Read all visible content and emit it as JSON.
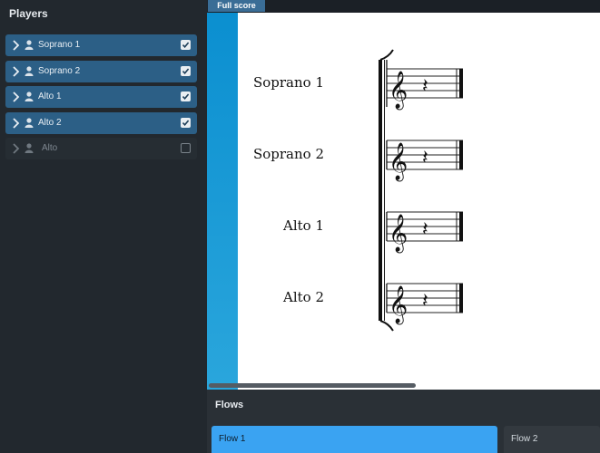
{
  "players_panel": {
    "title": "Players",
    "players": [
      {
        "name": "Soprano 1",
        "selected": true,
        "checked": true
      },
      {
        "name": "Soprano 2",
        "selected": true,
        "checked": true
      },
      {
        "name": "Alto 1",
        "selected": true,
        "checked": true
      },
      {
        "name": "Alto 2",
        "selected": true,
        "checked": true
      },
      {
        "name": "Alto",
        "selected": false,
        "checked": false
      }
    ]
  },
  "tabs": {
    "full_score": "Full score"
  },
  "score": {
    "staves": [
      "Soprano 1",
      "Soprano 2",
      "Alto 1",
      "Alto 2"
    ]
  },
  "flows_panel": {
    "title": "Flows",
    "flows": [
      {
        "name": "Flow 1",
        "selected": true
      },
      {
        "name": "Flow 2",
        "selected": false
      }
    ]
  },
  "colors": {
    "selected_row": "#2c5f86",
    "accent": "#3aa3f2",
    "tab": "#3a6d96"
  }
}
